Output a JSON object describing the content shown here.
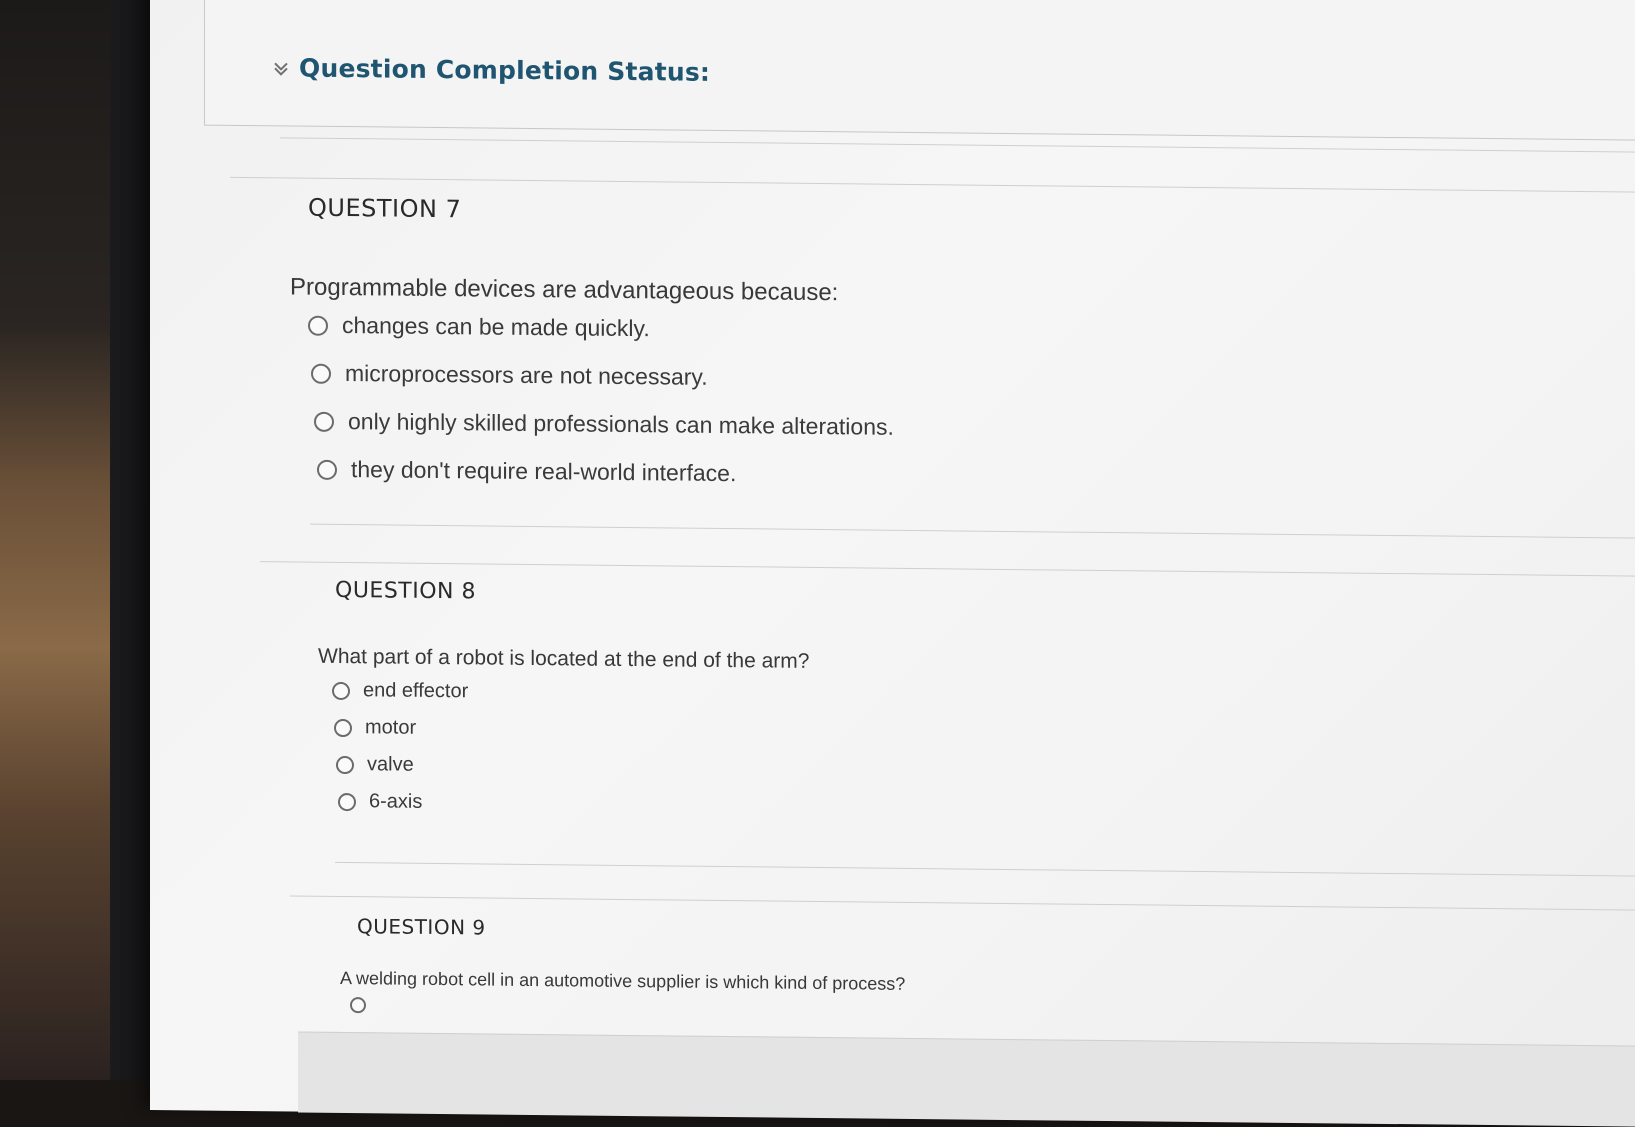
{
  "status": {
    "title": "Question Completion Status:"
  },
  "q7": {
    "heading": "QUESTION 7",
    "text": "Programmable devices are advantageous because:",
    "options": [
      "changes can be made quickly.",
      "microprocessors are not necessary.",
      "only highly skilled professionals can make alterations.",
      "they don't require real-world interface."
    ]
  },
  "q8": {
    "heading": "QUESTION 8",
    "text": "What part of a robot is located at the end of the arm?",
    "options": [
      "end effector",
      "motor",
      "valve",
      "6-axis"
    ]
  },
  "q9": {
    "heading": "QUESTION 9",
    "text": "A welding robot cell in an automotive supplier is which kind of process?"
  },
  "colors": {
    "status_title": "#1f5570",
    "background": "#f4f4f4",
    "text": "#383838"
  }
}
